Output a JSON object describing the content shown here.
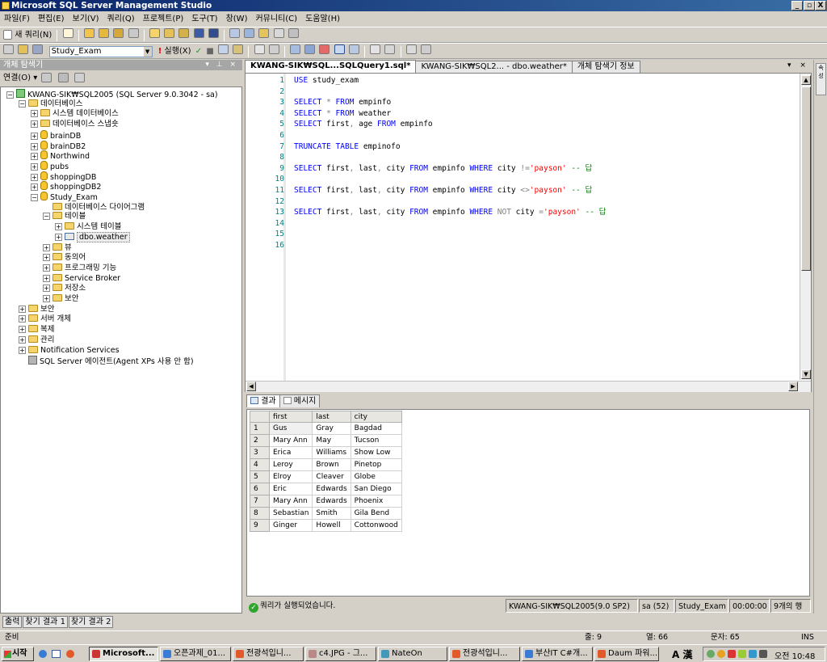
{
  "window": {
    "title": "Microsoft SQL Server Management Studio",
    "min": "_",
    "restore": "▫",
    "close": "X"
  },
  "menu": [
    "파일(F)",
    "편집(E)",
    "보기(V)",
    "쿼리(Q)",
    "프로젝트(P)",
    "도구(T)",
    "창(W)",
    "커뮤니티(C)",
    "도움말(H)"
  ],
  "toolbar": {
    "new_query": "새 쿼리(N)",
    "database": "Study_Exam",
    "execute": "실행(X)"
  },
  "object_explorer": {
    "title": "개체 탐색기",
    "connect": "연결(O) ▾",
    "tree": [
      {
        "label": "KWANG-SIK₩SQL2005 (SQL Server 9.0.3042 - sa)",
        "level": 0,
        "toggle": "−",
        "icon": "server"
      },
      {
        "label": "데이터베이스",
        "level": 1,
        "toggle": "−",
        "icon": "folder"
      },
      {
        "label": "시스템 데이터베이스",
        "level": 2,
        "toggle": "+",
        "icon": "folder"
      },
      {
        "label": "데이터베이스 스냅숏",
        "level": 2,
        "toggle": "+",
        "icon": "folder"
      },
      {
        "label": "brainDB",
        "level": 2,
        "toggle": "+",
        "icon": "db"
      },
      {
        "label": "brainDB2",
        "level": 2,
        "toggle": "+",
        "icon": "db"
      },
      {
        "label": "Northwind",
        "level": 2,
        "toggle": "+",
        "icon": "db"
      },
      {
        "label": "pubs",
        "level": 2,
        "toggle": "+",
        "icon": "db"
      },
      {
        "label": "shoppingDB",
        "level": 2,
        "toggle": "+",
        "icon": "db"
      },
      {
        "label": "shoppingDB2",
        "level": 2,
        "toggle": "+",
        "icon": "db"
      },
      {
        "label": "Study_Exam",
        "level": 2,
        "toggle": "−",
        "icon": "db"
      },
      {
        "label": "데이터베이스 다이어그램",
        "level": 3,
        "toggle": "",
        "icon": "folder"
      },
      {
        "label": "테이블",
        "level": 3,
        "toggle": "−",
        "icon": "folder"
      },
      {
        "label": "시스템 테이블",
        "level": 4,
        "toggle": "+",
        "icon": "folder"
      },
      {
        "label": "dbo.weather",
        "level": 4,
        "toggle": "+",
        "icon": "table",
        "selected": true
      },
      {
        "label": "뷰",
        "level": 3,
        "toggle": "+",
        "icon": "folder"
      },
      {
        "label": "동의어",
        "level": 3,
        "toggle": "+",
        "icon": "folder"
      },
      {
        "label": "프로그래밍 기능",
        "level": 3,
        "toggle": "+",
        "icon": "folder"
      },
      {
        "label": "Service Broker",
        "level": 3,
        "toggle": "+",
        "icon": "folder"
      },
      {
        "label": "저장소",
        "level": 3,
        "toggle": "+",
        "icon": "folder"
      },
      {
        "label": "보안",
        "level": 3,
        "toggle": "+",
        "icon": "folder"
      },
      {
        "label": "보안",
        "level": 1,
        "toggle": "+",
        "icon": "folder"
      },
      {
        "label": "서버 개체",
        "level": 1,
        "toggle": "+",
        "icon": "folder"
      },
      {
        "label": "복제",
        "level": 1,
        "toggle": "+",
        "icon": "folder"
      },
      {
        "label": "관리",
        "level": 1,
        "toggle": "+",
        "icon": "folder"
      },
      {
        "label": "Notification Services",
        "level": 1,
        "toggle": "+",
        "icon": "folder"
      },
      {
        "label": "SQL Server 에이전트(Agent XPs 사용 안 함)",
        "level": 1,
        "toggle": "",
        "icon": "agent"
      }
    ]
  },
  "bottom_tabs": [
    "출력",
    "찾기 결과 1",
    "찾기 결과 2"
  ],
  "doc_tabs": [
    "KWANG-SIK₩SQL...SQLQuery1.sql*",
    "KWANG-SIK₩SQL2... - dbo.weather*",
    "개체 탐색기 정보"
  ],
  "doc_controls": "▾ ×",
  "editor": {
    "lines": [
      "USE study_exam",
      "",
      "SELECT * FROM empinfo",
      "SELECT * FROM weather",
      "SELECT first, age FROM empinfo",
      "",
      "TRUNCATE TABLE empinofo",
      "",
      "SELECT first, last, city FROM empinfo WHERE city !='payson' -- 답",
      "",
      "SELECT first, last, city FROM empinfo WHERE city <>'payson' -- 답",
      "",
      "SELECT first, last, city FROM empinfo WHERE NOT city ='payson' -- 답",
      "",
      "",
      ""
    ]
  },
  "results_tabs": [
    "결과",
    "메시지"
  ],
  "grid": {
    "columns": [
      "first",
      "last",
      "city"
    ],
    "rows": [
      [
        "Gus",
        "Gray",
        "Bagdad"
      ],
      [
        "Mary Ann",
        "May",
        "Tucson"
      ],
      [
        "Erica",
        "Williams",
        "Show Low"
      ],
      [
        "Leroy",
        "Brown",
        "Pinetop"
      ],
      [
        "Elroy",
        "Cleaver",
        "Globe"
      ],
      [
        "Eric",
        "Edwards",
        "San Diego"
      ],
      [
        "Mary Ann",
        "Edwards",
        "Phoenix"
      ],
      [
        "Sebastian",
        "Smith",
        "Gila Bend"
      ],
      [
        "Ginger",
        "Howell",
        "Cottonwood"
      ]
    ]
  },
  "query_status": {
    "message": "쿼리가 실행되었습니다.",
    "server": "KWANG-SIK₩SQL2005(9.0 SP2)",
    "user": "sa (52)",
    "db": "Study_Exam",
    "time": "00:00:00",
    "rows": "9개의 행"
  },
  "status_bar": {
    "ready": "준비",
    "line": "줄: 9",
    "col": "열: 66",
    "ch": "문자: 65",
    "mode": "INS"
  },
  "taskbar": {
    "start": "시작",
    "buttons": [
      "Microsoft...",
      "오픈과제_01...",
      "전광석입니...",
      "c4.JPG - 그...",
      "NateOn",
      "전광석입니...",
      "부산IT C#개...",
      "Daum 파워..."
    ],
    "ime": "A 漢",
    "clock": "오전 10:48"
  },
  "right_strip_label": "속성"
}
